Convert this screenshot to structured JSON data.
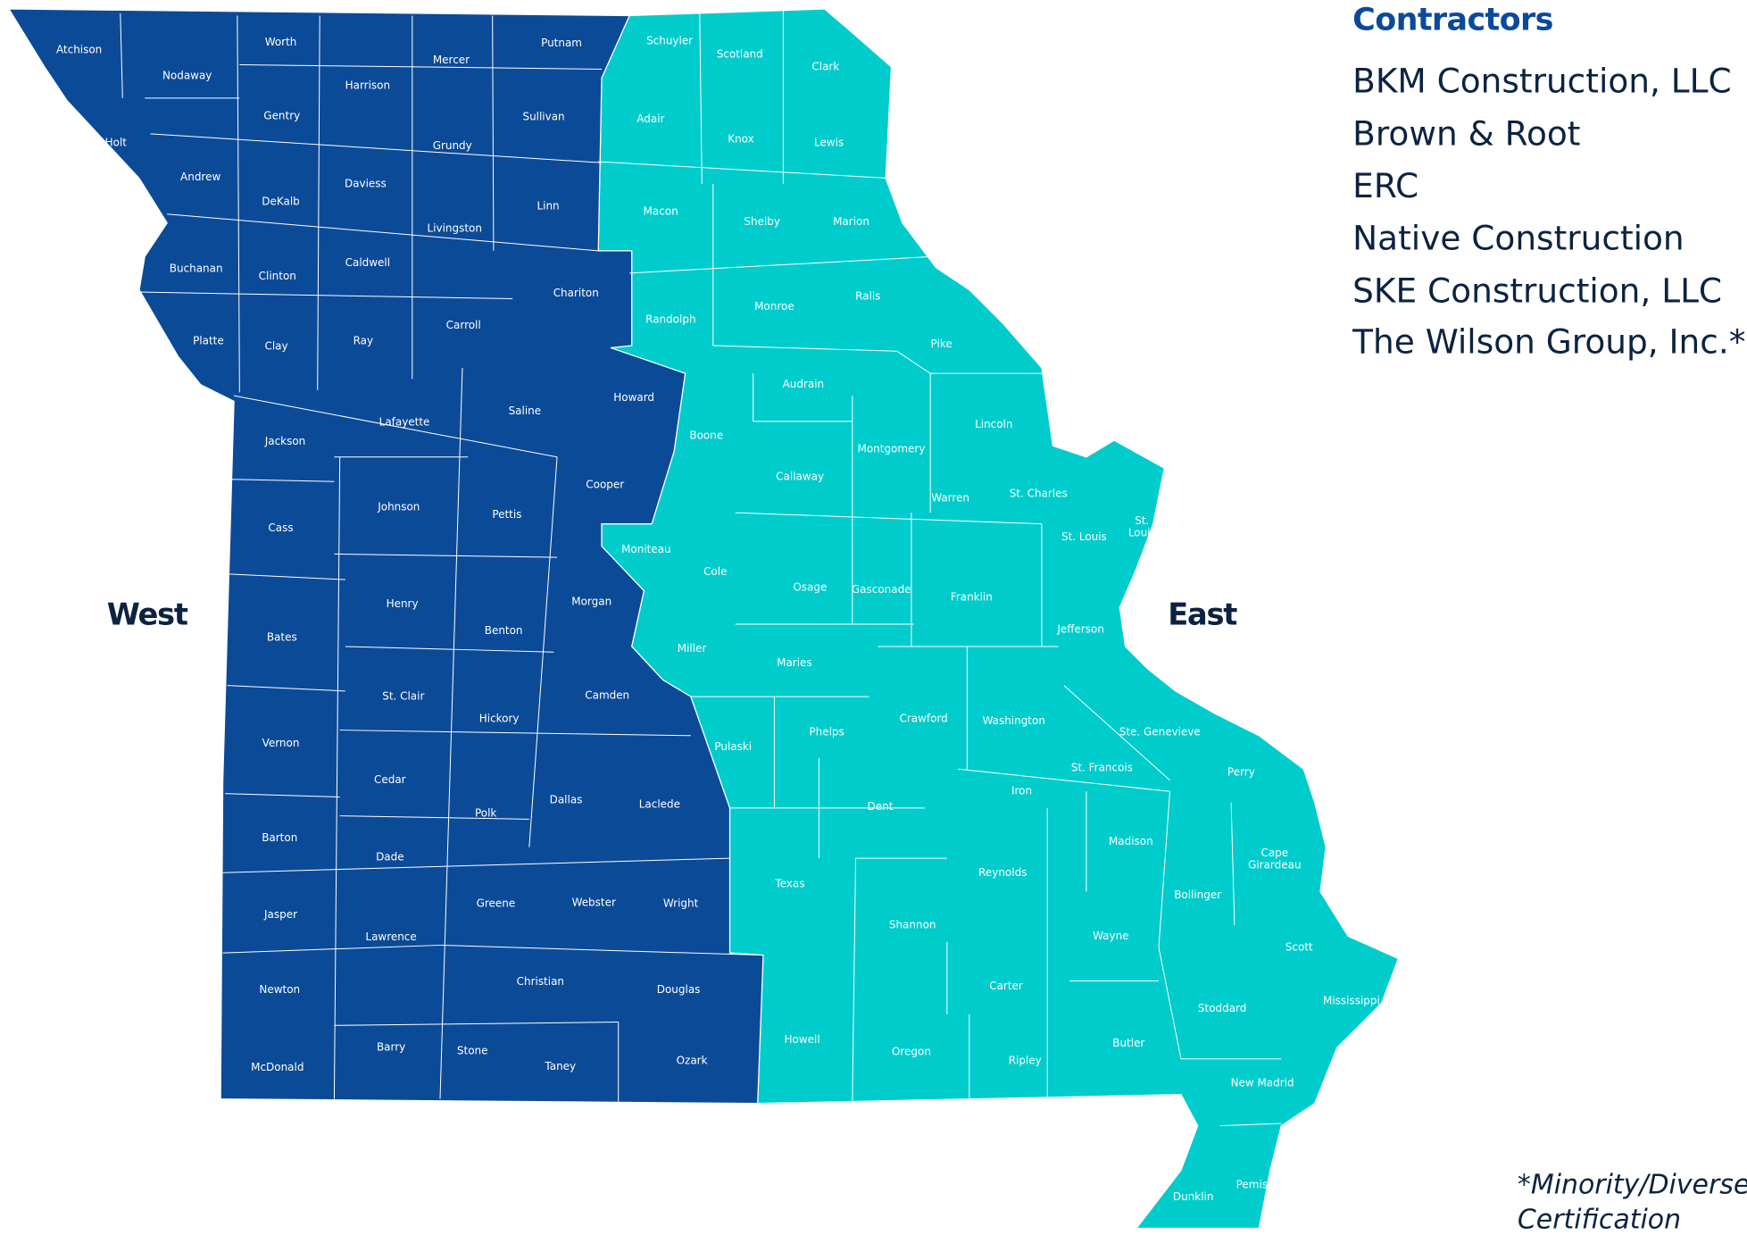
{
  "legend": {
    "title": "Contractors",
    "items": [
      "BKM Construction, LLC",
      "Brown & Root",
      "ERC",
      "Native Construction",
      "SKE Construction, LLC",
      "The Wilson Group, Inc.*"
    ],
    "footnote_line1": "*Minority/Diverse",
    "footnote_line2": "Certification"
  },
  "colors": {
    "west": "#0b4a97",
    "east": "#00cccc",
    "title": "#0b4a9a",
    "text": "#0c2340",
    "border": "#ffffff"
  },
  "regions": {
    "west": {
      "label": "West",
      "counties": [
        "Atchison",
        "Nodaway",
        "Worth",
        "Harrison",
        "Mercer",
        "Putnam",
        "Holt",
        "Gentry",
        "Grundy",
        "Sullivan",
        "Andrew",
        "DeKalb",
        "Daviess",
        "Livingston",
        "Linn",
        "Buchanan",
        "Clinton",
        "Caldwell",
        "Chariton",
        "Carroll",
        "Platte",
        "Clay",
        "Ray",
        "Howard",
        "Saline",
        "Lafayette",
        "Jackson",
        "Cooper",
        "Johnson",
        "Pettis",
        "Cass",
        "Henry",
        "Benton",
        "Morgan",
        "Bates",
        "St. Clair",
        "Hickory",
        "Camden",
        "Vernon",
        "Cedar",
        "Polk",
        "Dallas",
        "Laclede",
        "Barton",
        "Dade",
        "Greene",
        "Webster",
        "Wright",
        "Jasper",
        "Lawrence",
        "Christian",
        "Douglas",
        "Newton",
        "Barry",
        "Stone",
        "Taney",
        "Ozark",
        "McDonald"
      ]
    },
    "east": {
      "label": "East",
      "counties": [
        "Schuyler",
        "Scotland",
        "Clark",
        "Adair",
        "Knox",
        "Lewis",
        "Macon",
        "Shelby",
        "Marion",
        "Randolph",
        "Monroe",
        "Ralls",
        "Pike",
        "Audrain",
        "Boone",
        "Lincoln",
        "Callaway",
        "Montgomery",
        "Warren",
        "St. Charles",
        "St. Louis",
        "St. Louis",
        "Moniteau",
        "Cole",
        "Osage",
        "Gasconade",
        "Franklin",
        "Jefferson",
        "Miller",
        "Maries",
        "Pulaski",
        "Phelps",
        "Crawford",
        "Washington",
        "Ste. Genevieve",
        "St. Francois",
        "Perry",
        "Iron",
        "Dent",
        "Madison",
        "Cape Girardeau",
        "Reynolds",
        "Texas",
        "Bollinger",
        "Shannon",
        "Wayne",
        "Scott",
        "Carter",
        "Mississippi",
        "Stoddard",
        "Howell",
        "Butler",
        "Oregon",
        "Ripley",
        "New Madrid",
        "Pemiscot",
        "Dunklin"
      ]
    }
  }
}
